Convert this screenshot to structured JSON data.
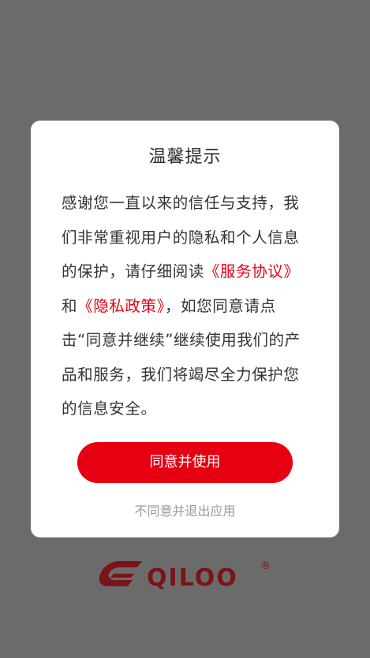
{
  "dialog": {
    "title": "温馨提示",
    "lines": [
      {
        "text": "感谢您一直以来的信任与支持，我"
      },
      {
        "text": "们非常重视用户的隐私和个人信息"
      },
      {
        "prefix": "的保护，请仔细阅读",
        "link": "《服务协议》"
      },
      {
        "prefix": "和",
        "link": "《隐私政策》",
        "suffix": "，如您同意请点"
      },
      {
        "text": "击“同意并继续”继续使用我们的产"
      },
      {
        "text": "品和服务，我们将竭尽全力保护您"
      },
      {
        "text": "的信息安全。"
      }
    ],
    "agree_label": "同意并使用",
    "disagree_label": "不同意并退出应用"
  },
  "brand": {
    "logo_text": "QILOO",
    "registered_mark": "®",
    "logo_icon": "qiloo-logo-icon"
  },
  "colors": {
    "accent": "#e60012",
    "overlay": "#6b6b6b",
    "logo": "#7a1418",
    "text": "#333333",
    "muted": "#9a9a9a"
  }
}
